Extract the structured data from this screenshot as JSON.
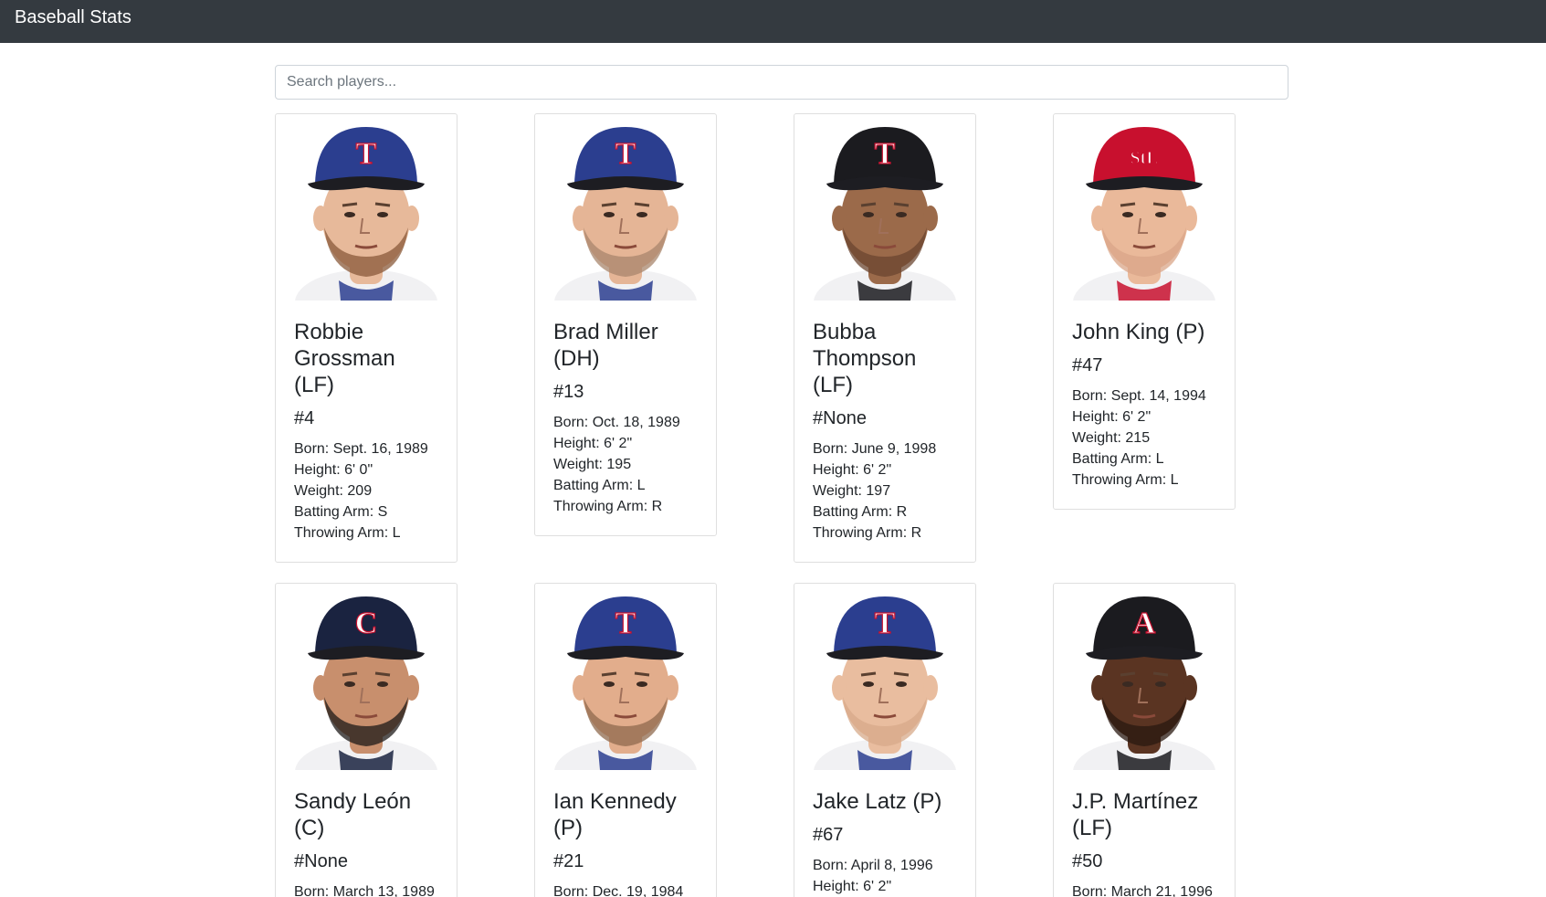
{
  "navbar": {
    "brand": "Baseball Stats"
  },
  "search": {
    "placeholder": "Search players..."
  },
  "players": [
    {
      "name": "Robbie Grossman (LF)",
      "number": "#4",
      "born": "Born: Sept. 16, 1989",
      "height": "Height: 6' 0\"",
      "weight": "Weight: 209",
      "batting": "Batting Arm: S",
      "throwing": "Throwing Arm: L",
      "cap_color": "#2b3e8f",
      "cap_letter": "T",
      "skin": "#e7b99a",
      "beard": "#8a5a3a"
    },
    {
      "name": "Brad Miller (DH)",
      "number": "#13",
      "born": "Born: Oct. 18, 1989",
      "height": "Height: 6' 2\"",
      "weight": "Weight: 195",
      "batting": "Batting Arm: L",
      "throwing": "Throwing Arm: R",
      "cap_color": "#2b3e8f",
      "cap_letter": "T",
      "skin": "#e5b596",
      "beard": "#a8866c"
    },
    {
      "name": "Bubba Thompson (LF)",
      "number": "#None",
      "born": "Born: June 9, 1998",
      "height": "Height: 6' 2\"",
      "weight": "Weight: 197",
      "batting": "Batting Arm: R",
      "throwing": "Throwing Arm: R",
      "cap_color": "#1b1b1f",
      "cap_letter": "T",
      "skin": "#9b6a4a",
      "beard": "#6b4630"
    },
    {
      "name": "John King (P)",
      "number": "#47",
      "born": "Born: Sept. 14, 1994",
      "height": "Height: 6' 2\"",
      "weight": "Weight: 215",
      "batting": "Batting Arm: L",
      "throwing": "Throwing Arm: L",
      "cap_color": "#c8102e",
      "cap_letter": "StL",
      "skin": "#eab99a",
      "beard": "#d9a688"
    },
    {
      "name": "Sandy León (C)",
      "number": "#None",
      "born": "Born: March 13, 1989",
      "height": "",
      "weight": "",
      "batting": "",
      "throwing": "",
      "cap_color": "#1a2340",
      "cap_letter": "C",
      "skin": "#c88f6d",
      "beard": "#1e1a18"
    },
    {
      "name": "Ian Kennedy (P)",
      "number": "#21",
      "born": "Born: Dec. 19, 1984",
      "height": "",
      "weight": "",
      "batting": "",
      "throwing": "",
      "cap_color": "#2b3e8f",
      "cap_letter": "T",
      "skin": "#e2ad8c",
      "beard": "#8f6a4e"
    },
    {
      "name": "Jake Latz (P)",
      "number": "#67",
      "born": "Born: April 8, 1996",
      "height": "Height: 6' 2\"",
      "weight": "",
      "batting": "",
      "throwing": "",
      "cap_color": "#2b3e8f",
      "cap_letter": "T",
      "skin": "#e9bd9f",
      "beard": "#d7a98a"
    },
    {
      "name": "J.P. Martínez (LF)",
      "number": "#50",
      "born": "Born: March 21, 1996",
      "height": "",
      "weight": "",
      "batting": "",
      "throwing": "",
      "cap_color": "#1b1b1f",
      "cap_letter": "A",
      "skin": "#5a3422",
      "beard": "#2a1810"
    }
  ]
}
